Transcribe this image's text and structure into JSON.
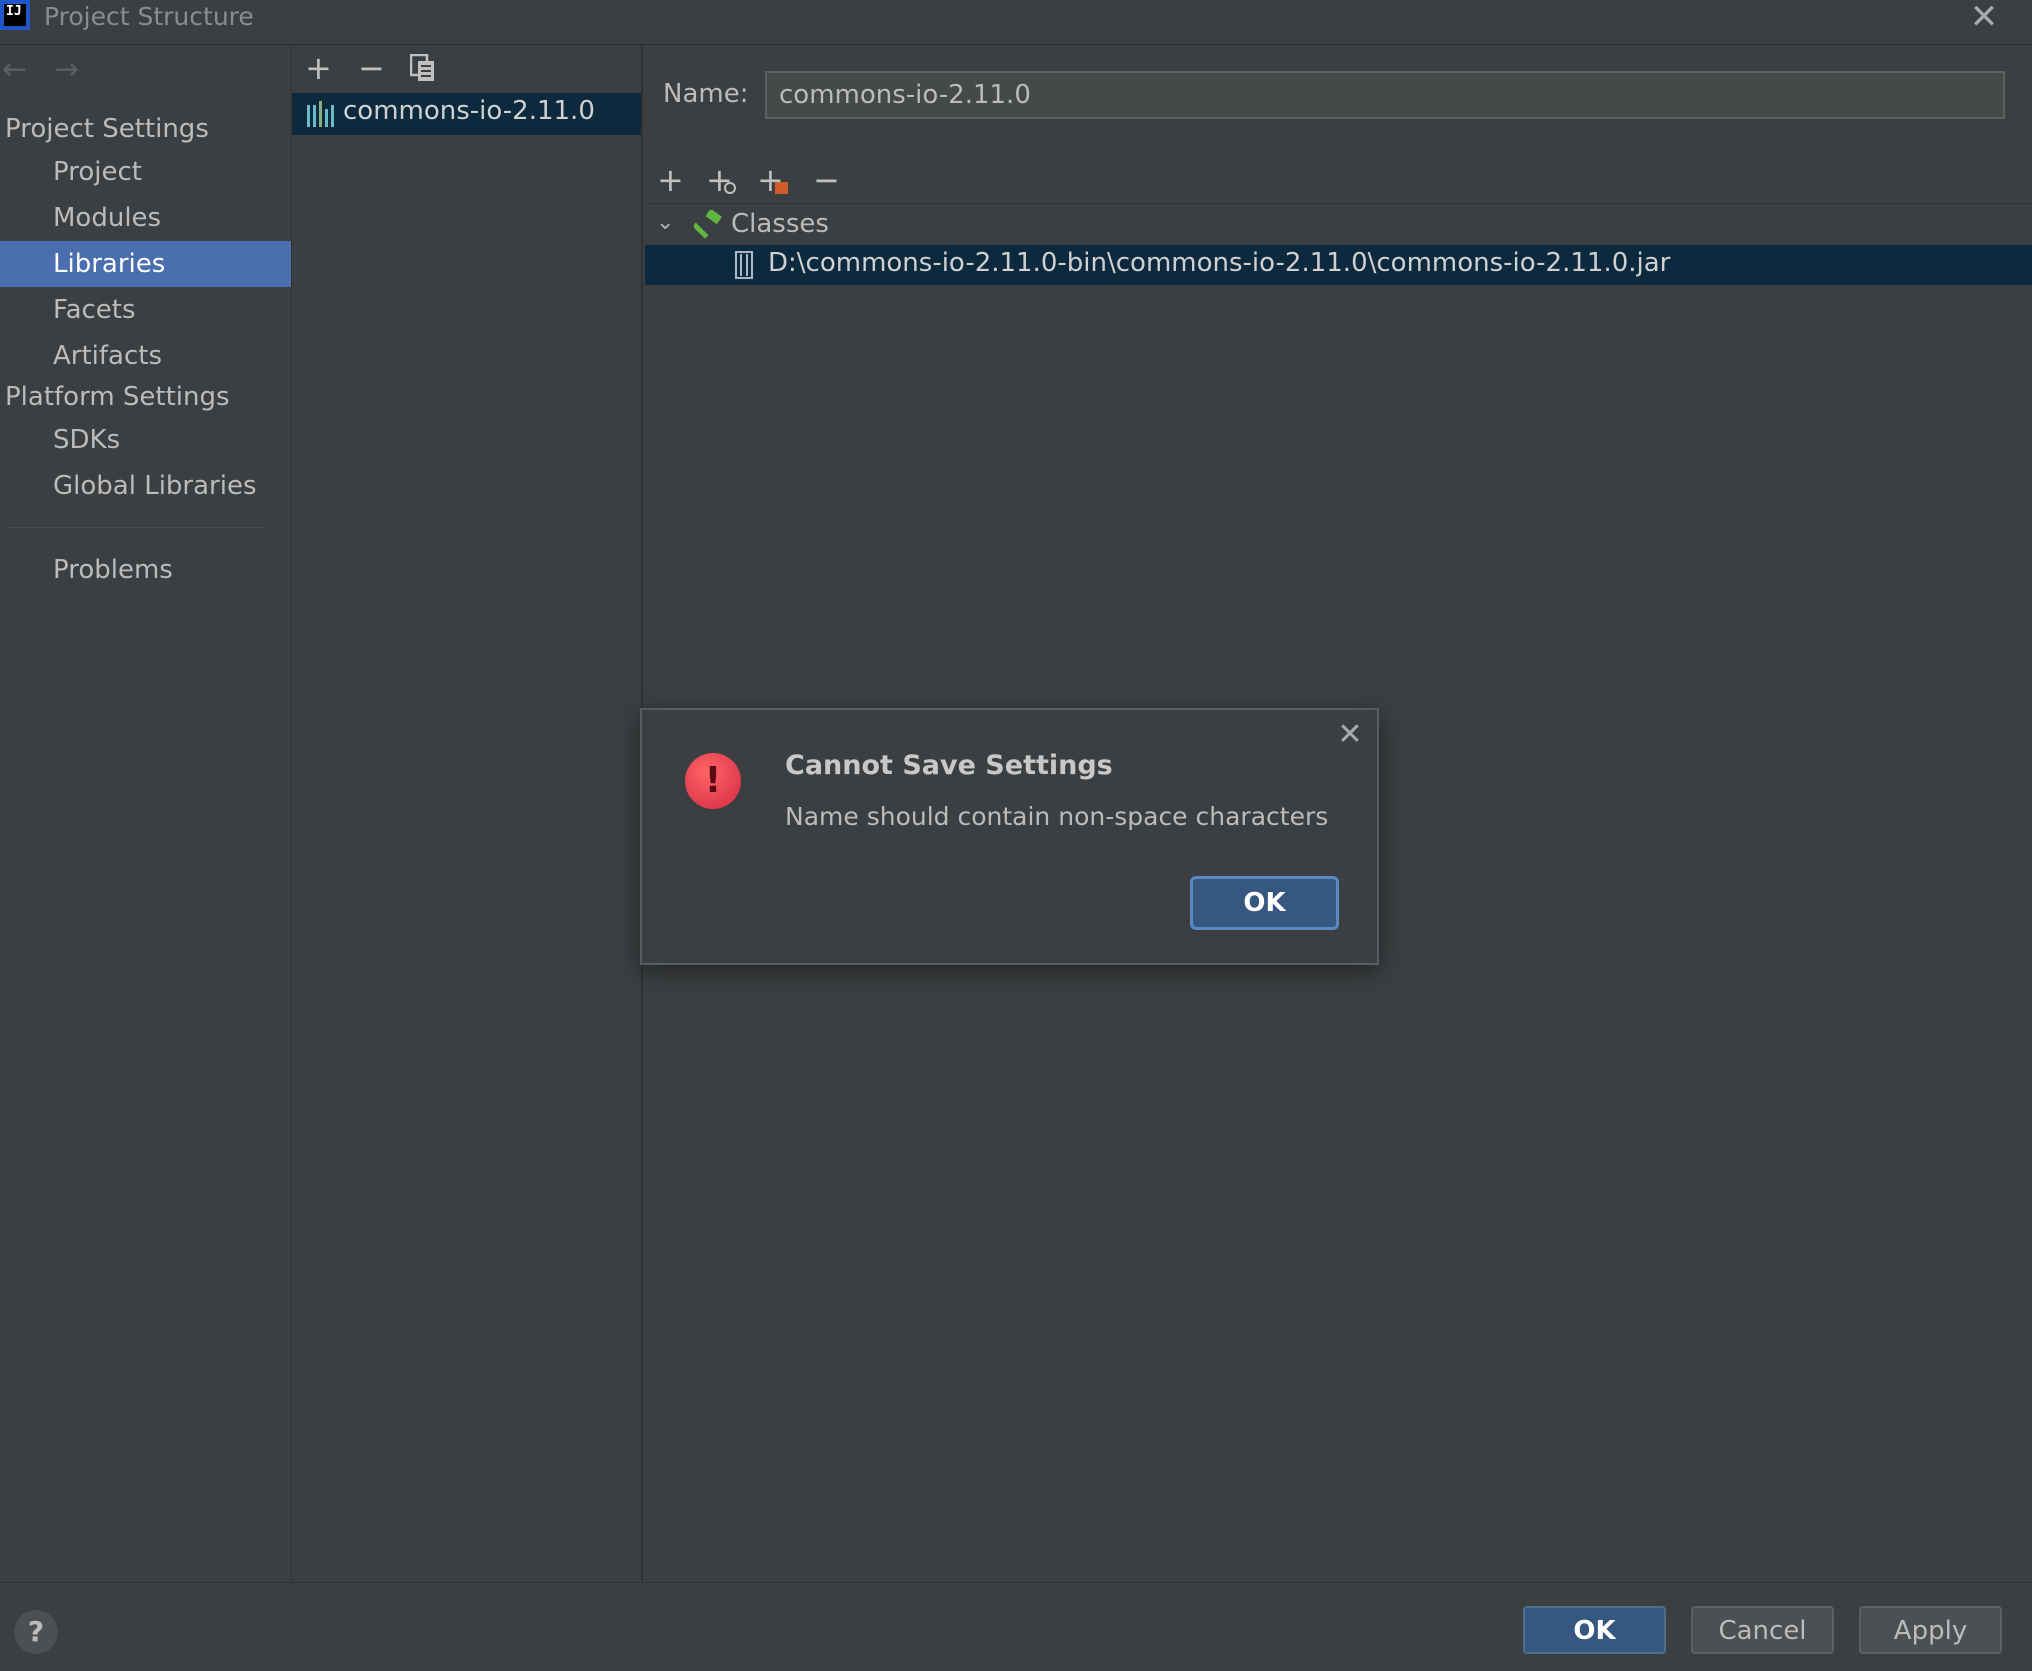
{
  "window": {
    "title": "Project Structure",
    "close_glyph": "✕",
    "app_icon_text": "IJ"
  },
  "nav": {
    "back_glyph": "←",
    "forward_glyph": "→",
    "project_settings_header": "Project Settings",
    "platform_settings_header": "Platform Settings",
    "items": [
      {
        "label": "Project"
      },
      {
        "label": "Modules"
      },
      {
        "label": "Libraries"
      },
      {
        "label": "Facets"
      },
      {
        "label": "Artifacts"
      },
      {
        "label": "SDKs"
      },
      {
        "label": "Global Libraries"
      },
      {
        "label": "Problems"
      }
    ],
    "selected": "Libraries"
  },
  "libraries": {
    "toolbar": {
      "add": "+",
      "remove": "−",
      "copy_icon": "copy-icon"
    },
    "items": [
      {
        "label": "commons-io-2.11.0"
      }
    ]
  },
  "detail": {
    "name_label": "Name:",
    "name_value": "commons-io-2.11.0",
    "toolbar": {
      "add": "+",
      "add_url": "+",
      "add_jar": "+",
      "remove": "−"
    },
    "classes_label": "Classes",
    "jar_path": "D:\\commons-io-2.11.0-bin\\commons-io-2.11.0\\commons-io-2.11.0.jar"
  },
  "footer": {
    "help": "?",
    "ok": "OK",
    "cancel": "Cancel",
    "apply": "Apply"
  },
  "dialog": {
    "title": "Cannot Save Settings",
    "message": "Name should contain non-space characters",
    "ok": "OK",
    "close_glyph": "✕",
    "error_glyph": "!"
  },
  "colors": {
    "background": "#3c3f41",
    "selection": "#4b6eaf",
    "row_selection": "#0d293e",
    "primary_button": "#365880",
    "error": "#e03a4e"
  }
}
